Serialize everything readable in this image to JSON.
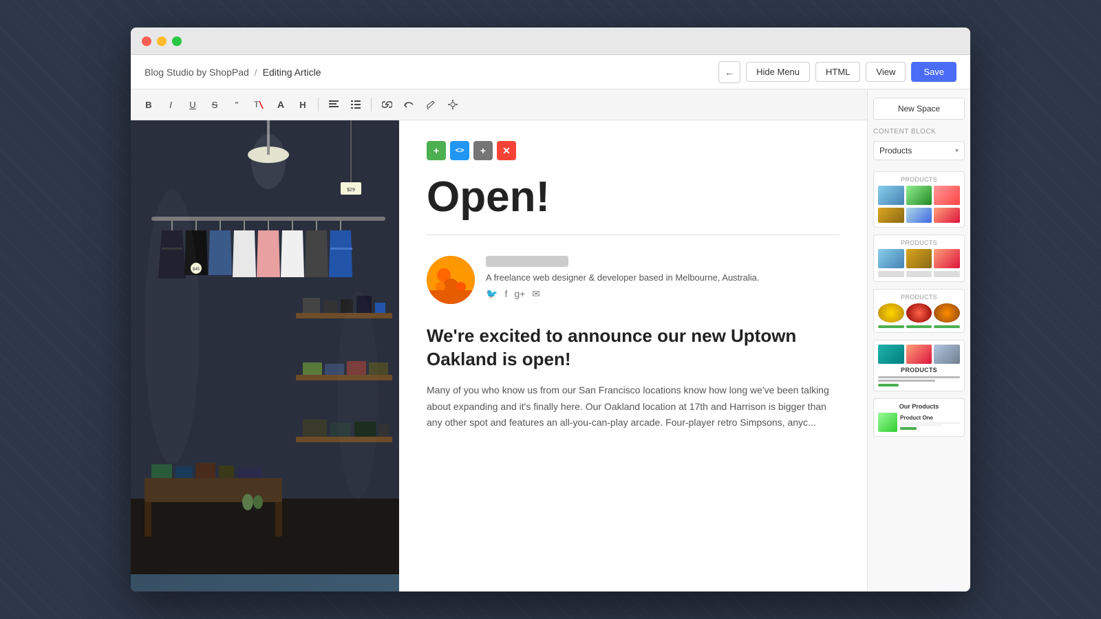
{
  "window": {
    "title": "Blog Studio by ShopPad"
  },
  "header": {
    "breadcrumb_app": "Blog Studio by ShopPad",
    "breadcrumb_separator": "/",
    "breadcrumb_current": "Editing Article",
    "btn_back": "←",
    "btn_hide_menu": "Hide Menu",
    "btn_html": "HTML",
    "btn_view": "View",
    "btn_save": "Save"
  },
  "toolbar": {
    "buttons": [
      {
        "name": "bold",
        "label": "B"
      },
      {
        "name": "italic",
        "label": "I"
      },
      {
        "name": "underline",
        "label": "U"
      },
      {
        "name": "strikethrough",
        "label": "S"
      },
      {
        "name": "quote",
        "label": "\""
      },
      {
        "name": "clear-format",
        "label": "T̶"
      },
      {
        "name": "heading",
        "label": "A"
      },
      {
        "name": "heading2",
        "label": "H"
      },
      {
        "name": "align-left",
        "label": "≡"
      },
      {
        "name": "list",
        "label": "≔"
      },
      {
        "name": "link",
        "label": "🔗"
      },
      {
        "name": "undo",
        "label": "↩"
      },
      {
        "name": "brush",
        "label": "✏"
      },
      {
        "name": "sparkle",
        "label": "✦"
      }
    ]
  },
  "block_buttons": [
    {
      "name": "add",
      "label": "+",
      "color": "green"
    },
    {
      "name": "code",
      "label": "<>",
      "color": "blue"
    },
    {
      "name": "move",
      "label": "+",
      "color": "gray"
    },
    {
      "name": "delete",
      "label": "✕",
      "color": "red"
    }
  ],
  "article": {
    "title": "Open!",
    "author_bio": "A freelance web designer & developer based in Melbourne, Australia.",
    "heading": "We're excited to announce our new Uptown Oakland is open!",
    "body": "Many of you who know us from our San Francisco locations know how long we've been talking about expanding and it's finally here. Our Oakland location at 17th and Harrison is bigger than any other spot and features an all-you-can-play arcade. Four-player retro Simpsons, anyc..."
  },
  "right_panel": {
    "new_space_label": "New Space",
    "content_block_label": "CONTENT BLOCK",
    "products_label": "Products",
    "template_cards": [
      {
        "label": "PRODUCTS",
        "type": "grid-with-bottom"
      },
      {
        "label": "Products",
        "type": "grid-two-rows"
      },
      {
        "label": "Products",
        "type": "circles-with-bars"
      },
      {
        "label": "",
        "type": "landscape-text",
        "show_products_label": true
      },
      {
        "label": "",
        "type": "our-products"
      }
    ]
  }
}
